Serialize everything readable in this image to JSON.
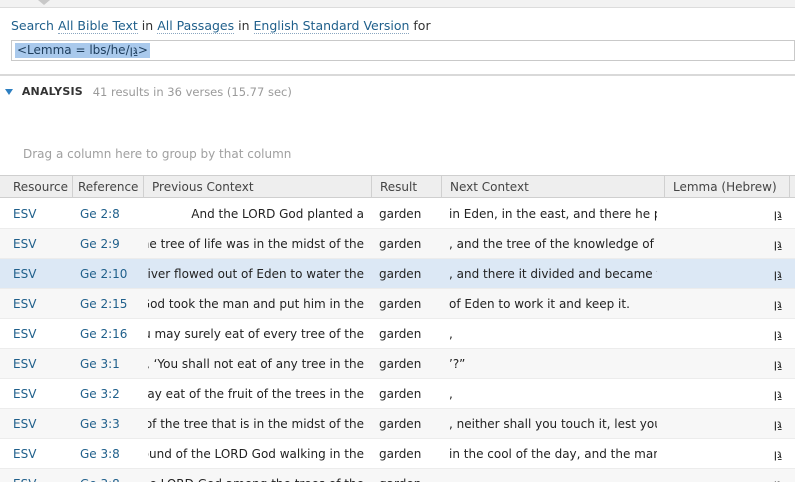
{
  "search": {
    "prefix": "Search",
    "scope": "All Bible Text",
    "in1": "in",
    "passages": "All Passages",
    "in2": "in",
    "version": "English Standard Version",
    "for": "for",
    "query": "<Lemma = lbs/he/גַּן>"
  },
  "analysis": {
    "label": "ANALYSIS",
    "stats": "41 results in 36 verses (15.77 sec)"
  },
  "group_hint": "Drag a column here to group by that column",
  "columns": {
    "resource": "Resource",
    "reference": "Reference",
    "previous": "Previous Context",
    "result": "Result",
    "next": "Next Context",
    "lemma": "Lemma (Hebrew)"
  },
  "rows": [
    {
      "resource": "ESV",
      "reference": "Ge 2:8",
      "previous": "And the LORD God planted a",
      "result": "garden",
      "next": "in Eden, in the east, and there he put the",
      "lemma": "גַּן"
    },
    {
      "resource": "ESV",
      "reference": "Ge 2:9",
      "previous": "d. The tree of life was in the midst of the",
      "result": "garden",
      "next": ", and the tree of the knowledge of good",
      "lemma": "גַּן"
    },
    {
      "resource": "ESV",
      "reference": "Ge 2:10",
      "previous": "A river flowed out of Eden to water the",
      "result": "garden",
      "next": ", and there it divided and became four",
      "lemma": "גַּן"
    },
    {
      "resource": "ESV",
      "reference": "Ge 2:15",
      "previous": "RD God took the man and put him in the",
      "result": "garden",
      "next": "of Eden to work it and keep it.",
      "lemma": "גַּן"
    },
    {
      "resource": "ESV",
      "reference": "Ge 2:16",
      "previous": "“You may surely eat of every tree of the",
      "result": "garden",
      "next": ",",
      "lemma": "גַּן"
    },
    {
      "resource": "ESV",
      "reference": "Ge 3:1",
      "previous": "say, ‘You shall not eat of any tree in the",
      "result": "garden",
      "next": "’?”",
      "lemma": "גַּן"
    },
    {
      "resource": "ESV",
      "reference": "Ge 3:2",
      "previous": "Ve may eat of the fruit of the trees in the",
      "result": "garden",
      "next": ",",
      "lemma": "גַּן"
    },
    {
      "resource": "ESV",
      "reference": "Ge 3:3",
      "previous": "ruit of the tree that is in the midst of the",
      "result": "garden",
      "next": ", neither shall you touch it, lest you die",
      "lemma": "גַּן"
    },
    {
      "resource": "ESV",
      "reference": "Ge 3:8",
      "previous": "e sound of the LORD God walking in the",
      "result": "garden",
      "next": "in the cool of the day, and the man and",
      "lemma": "גַּן"
    },
    {
      "resource": "ESV",
      "reference": "Ge 3:8",
      "previous": "of the LORD God among the trees of the",
      "result": "garden",
      "next": "",
      "lemma": "גַּן"
    }
  ],
  "selected_row": 2
}
